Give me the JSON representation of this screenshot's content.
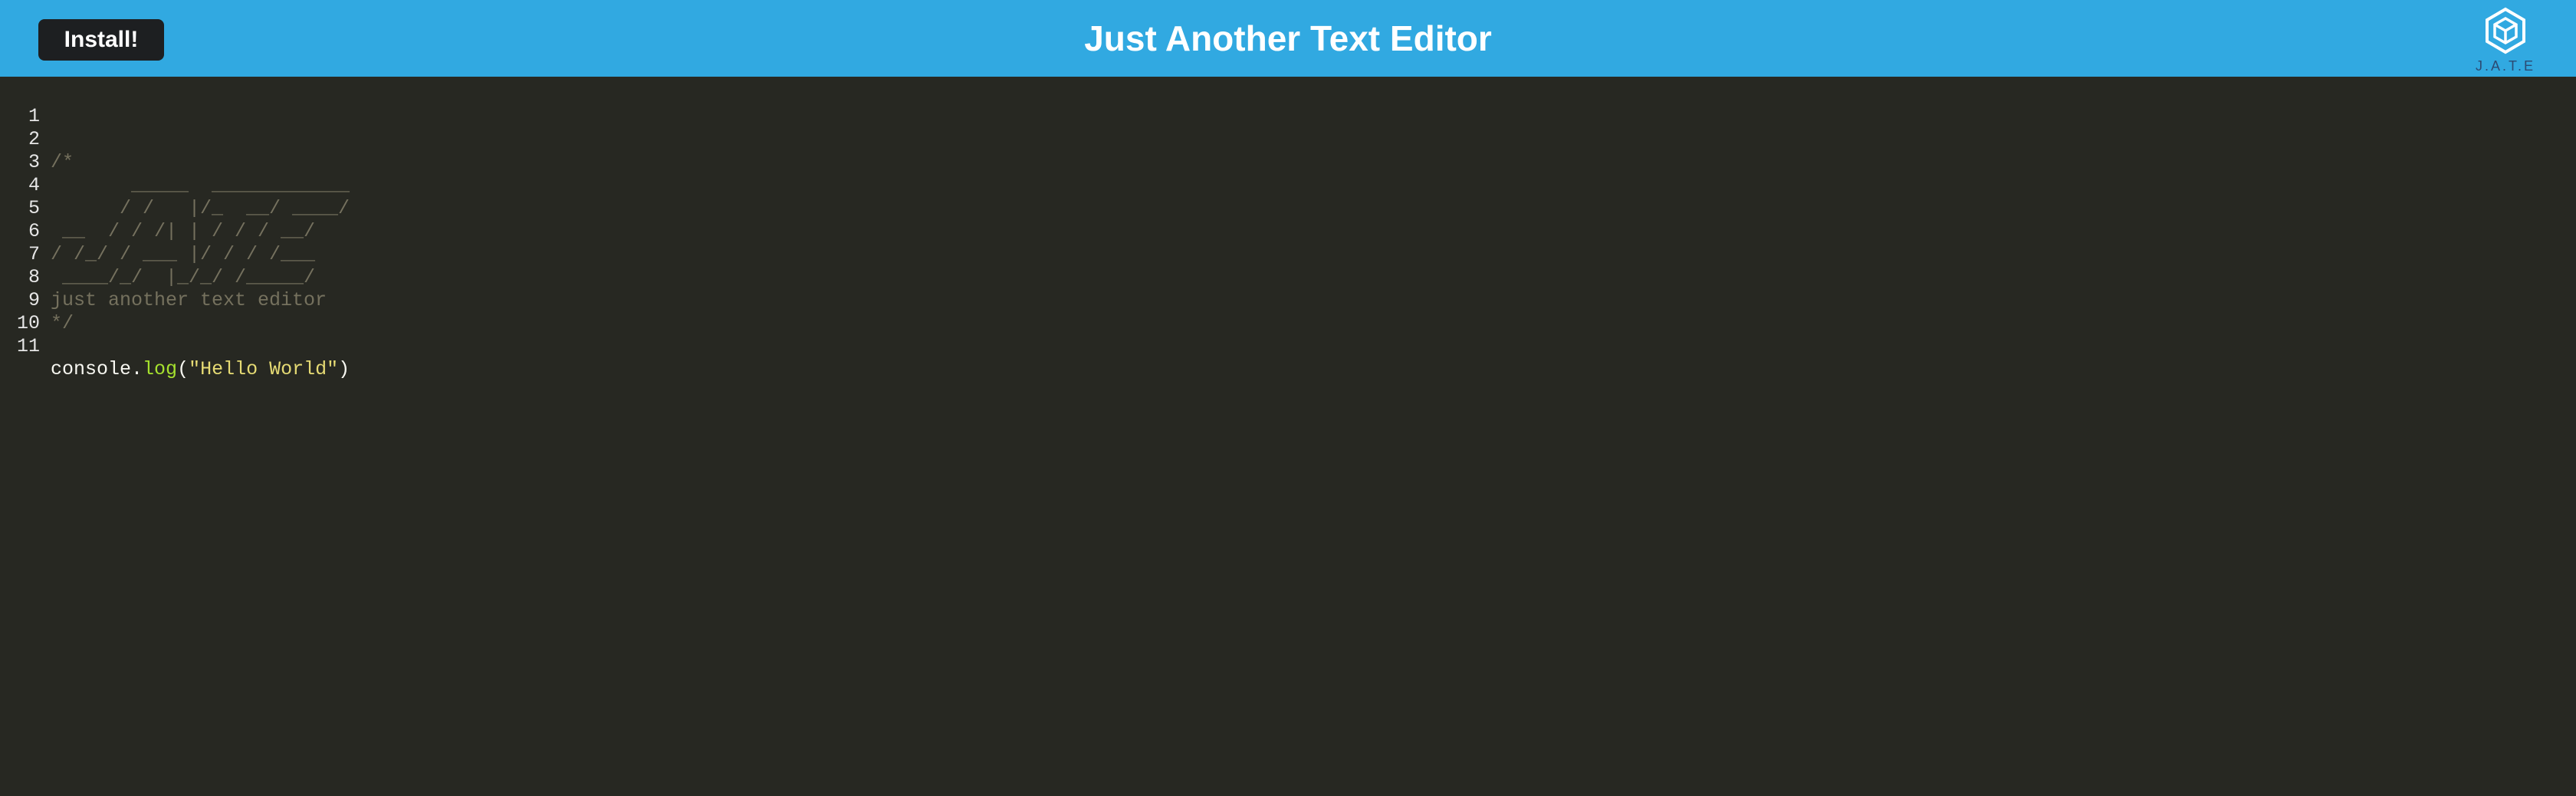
{
  "header": {
    "install_label": "Install!",
    "title": "Just Another Text Editor",
    "logo_text": "J.A.T.E",
    "background": "#31a9e1"
  },
  "editor": {
    "lines": [
      {
        "number": "1",
        "text": ""
      },
      {
        "number": "2",
        "text": "/*"
      },
      {
        "number": "3",
        "text": "       _____  ____________"
      },
      {
        "number": "4",
        "text": "      / /   |/_  __/ ____/"
      },
      {
        "number": "5",
        "text": " __  / / /| | / / / __/"
      },
      {
        "number": "6",
        "text": "/ /_/ / ___ |/ / / /___"
      },
      {
        "number": "7",
        "text": " ____/_/  |_/_/ /_____/"
      },
      {
        "number": "8",
        "text": "just another text editor"
      },
      {
        "number": "9",
        "text": "*/"
      },
      {
        "number": "10",
        "text": ""
      },
      {
        "number": "11",
        "tokens": {
          "object": "console",
          "dot": ".",
          "method": "log",
          "open": "(",
          "string": "\"Hello World\"",
          "close": ")"
        }
      }
    ],
    "theme": {
      "background": "#272822",
      "comment": "#75715e",
      "function": "#a6e22e",
      "string": "#e6db74",
      "text": "#f8f8f2"
    }
  },
  "icons": {
    "logo": "cube-logo-icon"
  }
}
